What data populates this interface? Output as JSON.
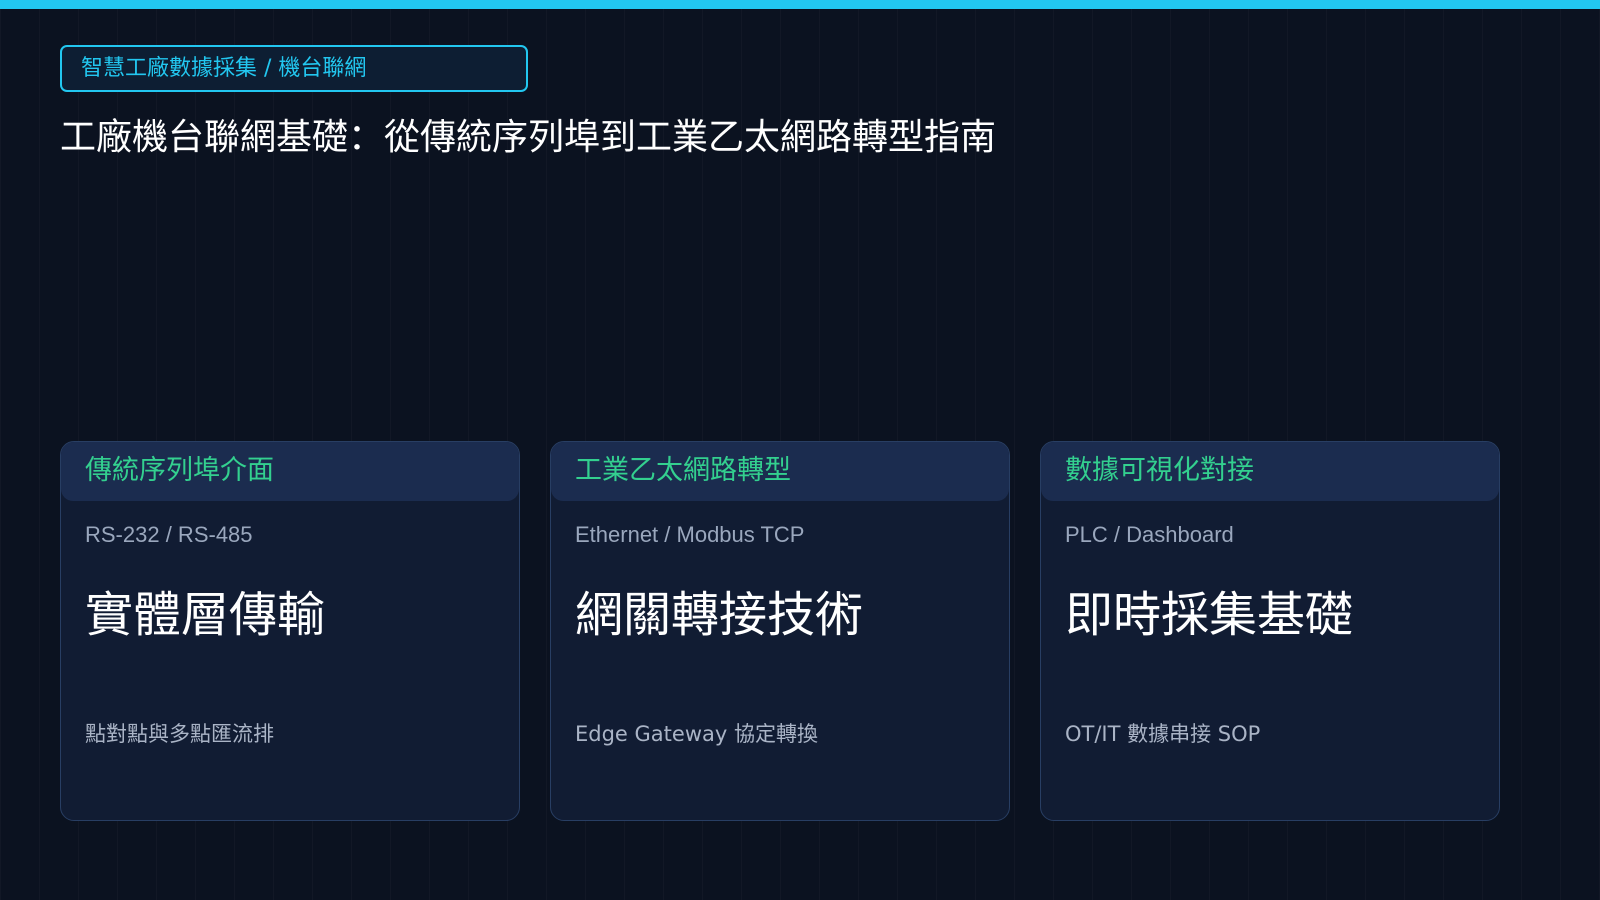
{
  "colors": {
    "background": "#0b1220",
    "accent_cyan": "#22c7f0",
    "accent_green": "#33d08f",
    "card_background": "#111c33",
    "card_header_background": "#1b2c4f"
  },
  "header": {
    "category": "智慧工廠數據採集 / 機台聯網",
    "title": "工廠機台聯網基礎：從傳統序列埠到工業乙太網路轉型指南"
  },
  "cards": [
    {
      "header": "傳統序列埠介面",
      "subtitle": "RS-232 / RS-485",
      "heading": "實體層傳輸",
      "description": "點對點與多點匯流排"
    },
    {
      "header": "工業乙太網路轉型",
      "subtitle": "Ethernet / Modbus TCP",
      "heading": "網關轉接技術",
      "description": "Edge Gateway 協定轉換"
    },
    {
      "header": "數據可視化對接",
      "subtitle": "PLC / Dashboard",
      "heading": "即時採集基礎",
      "description": "OT/IT 數據串接 SOP"
    }
  ]
}
